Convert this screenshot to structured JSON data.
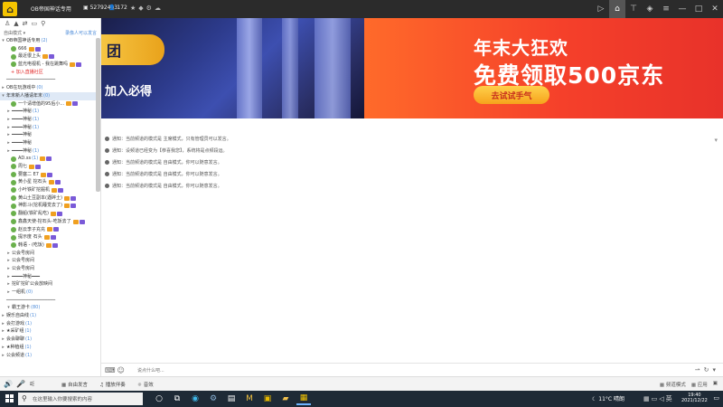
{
  "titlebar": {
    "app_logo": "⌂",
    "room_title": "OB帝国神话专用",
    "room_id": "52792403",
    "online_count": "172",
    "icons": [
      "star-icon",
      "bell-icon",
      "gear-icon",
      "cloud-icon"
    ],
    "window_controls": [
      "screen-icon",
      "home-icon",
      "tshirt-icon",
      "gamepad-icon",
      "menu-icon",
      "minimize-icon",
      "maximize-icon",
      "close-icon"
    ]
  },
  "sidebar": {
    "mode_label": "自由模式 ▾",
    "mode_right": "录像人可以发言",
    "tree": [
      {
        "text": "OB帝国神话专用",
        "count": "(2)",
        "kind": "channel",
        "caret": "▾"
      },
      {
        "text": "666",
        "kind": "user"
      },
      {
        "text": "最近很上头",
        "kind": "user"
      },
      {
        "text": "蓝光电视机 - 我在跳舞吗",
        "kind": "user"
      },
      {
        "text": "+ 加入直播社区",
        "kind": "red"
      },
      {
        "text": "━━━━━━━━━━━━━━━━━━",
        "kind": "divider"
      },
      {
        "text": "OB在玩游戏中",
        "count": "(0)",
        "kind": "channel",
        "caret": "▸"
      },
      {
        "text": "年末新人播请年末",
        "count": "(0)",
        "kind": "highlight",
        "caret": "▾"
      },
      {
        "text": "一个请增值的95后小...",
        "kind": "user"
      },
      {
        "text": "━━━━神秘",
        "count": "(1)",
        "kind": "channel",
        "caret": "▸"
      },
      {
        "text": "━━━━神秘",
        "count": "(1)",
        "kind": "channel",
        "caret": "▸"
      },
      {
        "text": "━━━━神秘",
        "count": "(1)",
        "kind": "channel",
        "caret": "▸"
      },
      {
        "text": "━━━━神秘",
        "kind": "channel",
        "caret": "▸"
      },
      {
        "text": "━━━━神秘",
        "kind": "channel",
        "caret": "▸"
      },
      {
        "text": "━━━━神秘",
        "count": "(1)",
        "kind": "channel",
        "caret": "▸"
      },
      {
        "text": "AD.ss",
        "count": "(1)",
        "kind": "user"
      },
      {
        "text": "周七",
        "kind": "user"
      },
      {
        "text": "要塞二 E7",
        "kind": "user"
      },
      {
        "text": "黄小星 挖石头",
        "kind": "user"
      },
      {
        "text": "小叶铁矿挖掘机",
        "kind": "user"
      },
      {
        "text": "黄山土豆副本(遇碎土)",
        "kind": "user"
      },
      {
        "text": "神影斗(挖机睡觉去了)",
        "kind": "user"
      },
      {
        "text": "翻船(铁矿乱吃)",
        "kind": "user"
      },
      {
        "text": "鑫鑫天使-挖石头-吃饭去了",
        "kind": "user"
      },
      {
        "text": "赵云李子充充",
        "kind": "user"
      },
      {
        "text": "提示度 石头",
        "kind": "user"
      },
      {
        "text": "韩语 - (吃饭)",
        "kind": "user"
      },
      {
        "text": "公会号房间",
        "kind": "channel",
        "caret": "▸"
      },
      {
        "text": "公会号房间",
        "kind": "channel",
        "caret": "▸"
      },
      {
        "text": "公会号房间",
        "kind": "channel",
        "caret": "▸"
      },
      {
        "text": "━━━━神秘━━━",
        "kind": "channel",
        "caret": "▸"
      },
      {
        "text": "挖矿挖矿公会放映间",
        "kind": "channel",
        "caret": "▸"
      },
      {
        "text": "一组机",
        "count": "(0)",
        "kind": "channel",
        "caret": "▸"
      },
      {
        "text": "━━━━━━━━━━━━━━━━━━",
        "kind": "divider"
      },
      {
        "text": "霸王游卡",
        "count": "(80)",
        "kind": "channel",
        "caret": "▾"
      },
      {
        "text": "娱乐自由线",
        "count": "(1)",
        "kind": "channel",
        "caret": "▸"
      },
      {
        "text": "会打游戏",
        "count": "(1)",
        "kind": "channel",
        "caret": "▸"
      },
      {
        "text": "★采矿组",
        "count": "(1)",
        "kind": "channel",
        "caret": "▸"
      },
      {
        "text": "会会聊聊",
        "count": "(1)",
        "kind": "channel",
        "caret": "▸"
      },
      {
        "text": "★种植组",
        "count": "(1)",
        "kind": "channel",
        "caret": "▸"
      },
      {
        "text": "公会频道",
        "count": "(1)",
        "kind": "channel",
        "caret": "▸"
      }
    ]
  },
  "banner": {
    "left_tag": "团",
    "left_slogan": "加入必得",
    "right_line1": "年末大狂欢",
    "right_line2": "免费领取500京东",
    "right_button": "去试试手气"
  },
  "messages": [
    "通知：当前频道的模式是 主席模式，只有管理员可以发言。",
    "通知：设频道已经变为【恭喜我您】，系统将是点频段运。",
    "通知：当前频道的模式是 自由模式，你可以随意发言。",
    "通知：当前频道的模式是 自由模式，你可以随意发言。",
    "通知：当前频道的模式是 自由模式，你可以随意发言。"
  ],
  "input": {
    "placeholder": "说点什么吧..."
  },
  "bottombar": {
    "free_talk": "自由发言",
    "music": "播放伴奏",
    "effects": "音效",
    "mode_label": "频道模式",
    "apps_label": "应用"
  },
  "taskbar": {
    "search_placeholder": "在这里输入你要搜索的内容",
    "weather": "11°C 晴朗",
    "time": "19:40",
    "date": "2021/12/22"
  },
  "colors": {
    "titlebar": "#2b2b2b",
    "accent": "#f5c400",
    "banner_orange": "#f5402a",
    "link_blue": "#4c8bd9",
    "taskbar": "#1e2a36"
  }
}
